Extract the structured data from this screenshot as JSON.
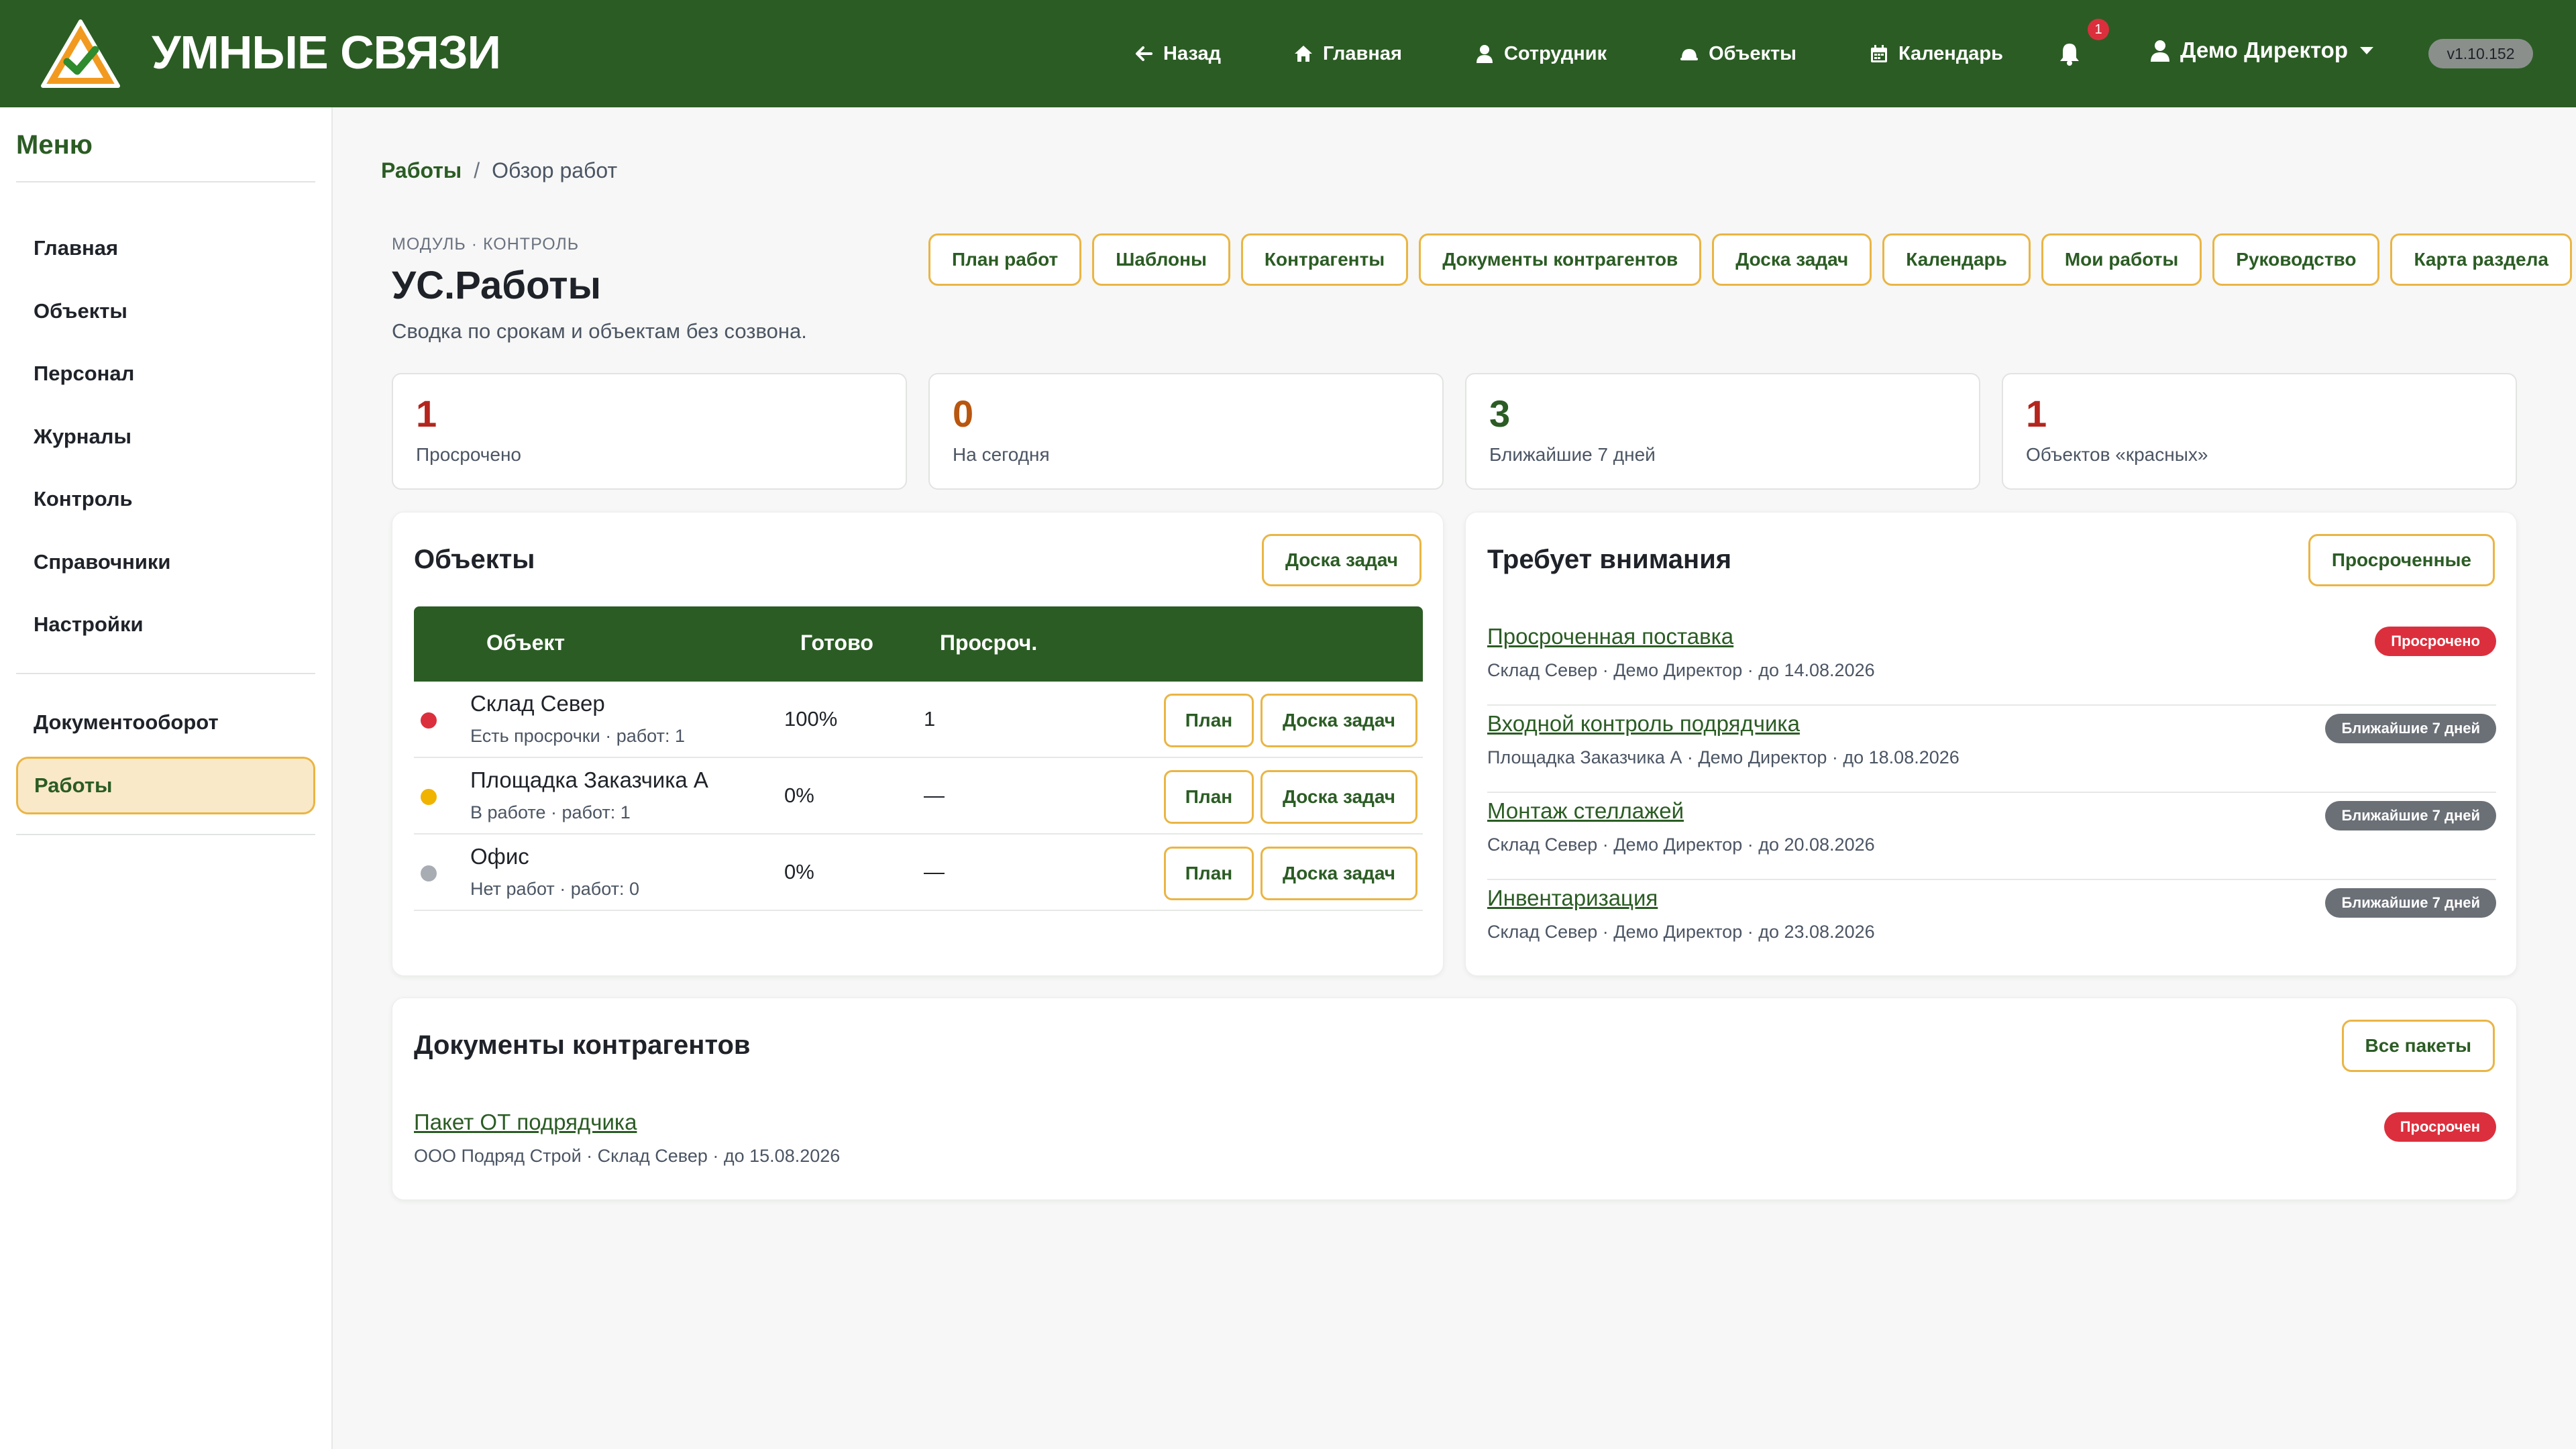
{
  "header": {
    "brand": "УМНЫЕ СВЯЗИ",
    "nav": [
      {
        "label": "Назад",
        "icon": "arrow-left-icon"
      },
      {
        "label": "Главная",
        "icon": "home-icon"
      },
      {
        "label": "Сотрудник",
        "icon": "user-icon"
      },
      {
        "label": "Объекты",
        "icon": "helmet-icon"
      },
      {
        "label": "Календарь",
        "icon": "calendar-icon"
      }
    ],
    "notifications_count": "1",
    "user_name": "Демо Директор",
    "version": "v1.10.152"
  },
  "sidebar": {
    "title": "Меню",
    "items": [
      {
        "label": "Главная"
      },
      {
        "label": "Объекты"
      },
      {
        "label": "Персонал"
      },
      {
        "label": "Журналы"
      },
      {
        "label": "Контроль"
      },
      {
        "label": "Справочники"
      },
      {
        "label": "Настройки"
      },
      {
        "label": "Документооборот"
      },
      {
        "label": "Работы",
        "active": true
      }
    ]
  },
  "breadcrumb": {
    "link": "Работы",
    "separator": "/",
    "current": "Обзор работ"
  },
  "page": {
    "eyebrow": "МОДУЛЬ · КОНТРОЛЬ",
    "title": "УС.Работы",
    "subtitle": "Сводка по срокам и объектам без созвона."
  },
  "quick_links": [
    "План работ",
    "Шаблоны",
    "Контрагенты",
    "Документы контрагентов",
    "Доска задач",
    "Календарь",
    "Мои работы",
    "Руководство",
    "Карта раздела"
  ],
  "stats": [
    {
      "value": "1",
      "label": "Просрочено",
      "color": "#b3261e"
    },
    {
      "value": "0",
      "label": "На сегодня",
      "color": "#b8560f"
    },
    {
      "value": "3",
      "label": "Ближайшие 7 дней",
      "color": "#2b5c24"
    },
    {
      "value": "1",
      "label": "Объектов «красных»",
      "color": "#b3261e"
    }
  ],
  "objects": {
    "title": "Объекты",
    "button": "Доска задач",
    "columns": [
      "Объект",
      "Готово",
      "Просроч."
    ],
    "rows": [
      {
        "name": "Склад Север",
        "meta": "Есть просрочки · работ: 1",
        "ready": "100%",
        "overdue": "1",
        "status_color": "#dc2f3d",
        "plan": "План",
        "board": "Доска задач"
      },
      {
        "name": "Площадка Заказчика А",
        "meta": "В работе · работ: 1",
        "ready": "0%",
        "overdue": "—",
        "status_color": "#f0b400",
        "plan": "План",
        "board": "Доска задач"
      },
      {
        "name": "Офис",
        "meta": "Нет работ · работ: 0",
        "ready": "0%",
        "overdue": "—",
        "status_color": "#a8adb3",
        "plan": "План",
        "board": "Доска задач"
      }
    ]
  },
  "attention": {
    "title": "Требует внимания",
    "button": "Просроченные",
    "items": [
      {
        "title": "Просроченная поставка",
        "meta": "Склад Север · Демо Директор · до 14.08.2026",
        "badge": "Просрочено",
        "badge_type": "red"
      },
      {
        "title": "Входной контроль подрядчика",
        "meta": "Площадка Заказчика А · Демо Директор · до 18.08.2026",
        "badge": "Ближайшие 7 дней",
        "badge_type": "gray"
      },
      {
        "title": "Монтаж стеллажей",
        "meta": "Склад Север · Демо Директор · до 20.08.2026",
        "badge": "Ближайшие 7 дней",
        "badge_type": "gray"
      },
      {
        "title": "Инвентаризация",
        "meta": "Склад Север · Демо Директор · до 23.08.2026",
        "badge": "Ближайшие 7 дней",
        "badge_type": "gray"
      }
    ]
  },
  "documents": {
    "title": "Документы контрагентов",
    "button": "Все пакеты",
    "items": [
      {
        "title": "Пакет ОТ подрядчика",
        "meta": "ООО Подряд Строй · Склад Север · до 15.08.2026",
        "badge": "Просрочен",
        "badge_type": "red"
      }
    ]
  },
  "colors": {
    "brand_green": "#2b5c24",
    "accent_yellow": "#eab544",
    "danger": "#dc2f3d"
  }
}
